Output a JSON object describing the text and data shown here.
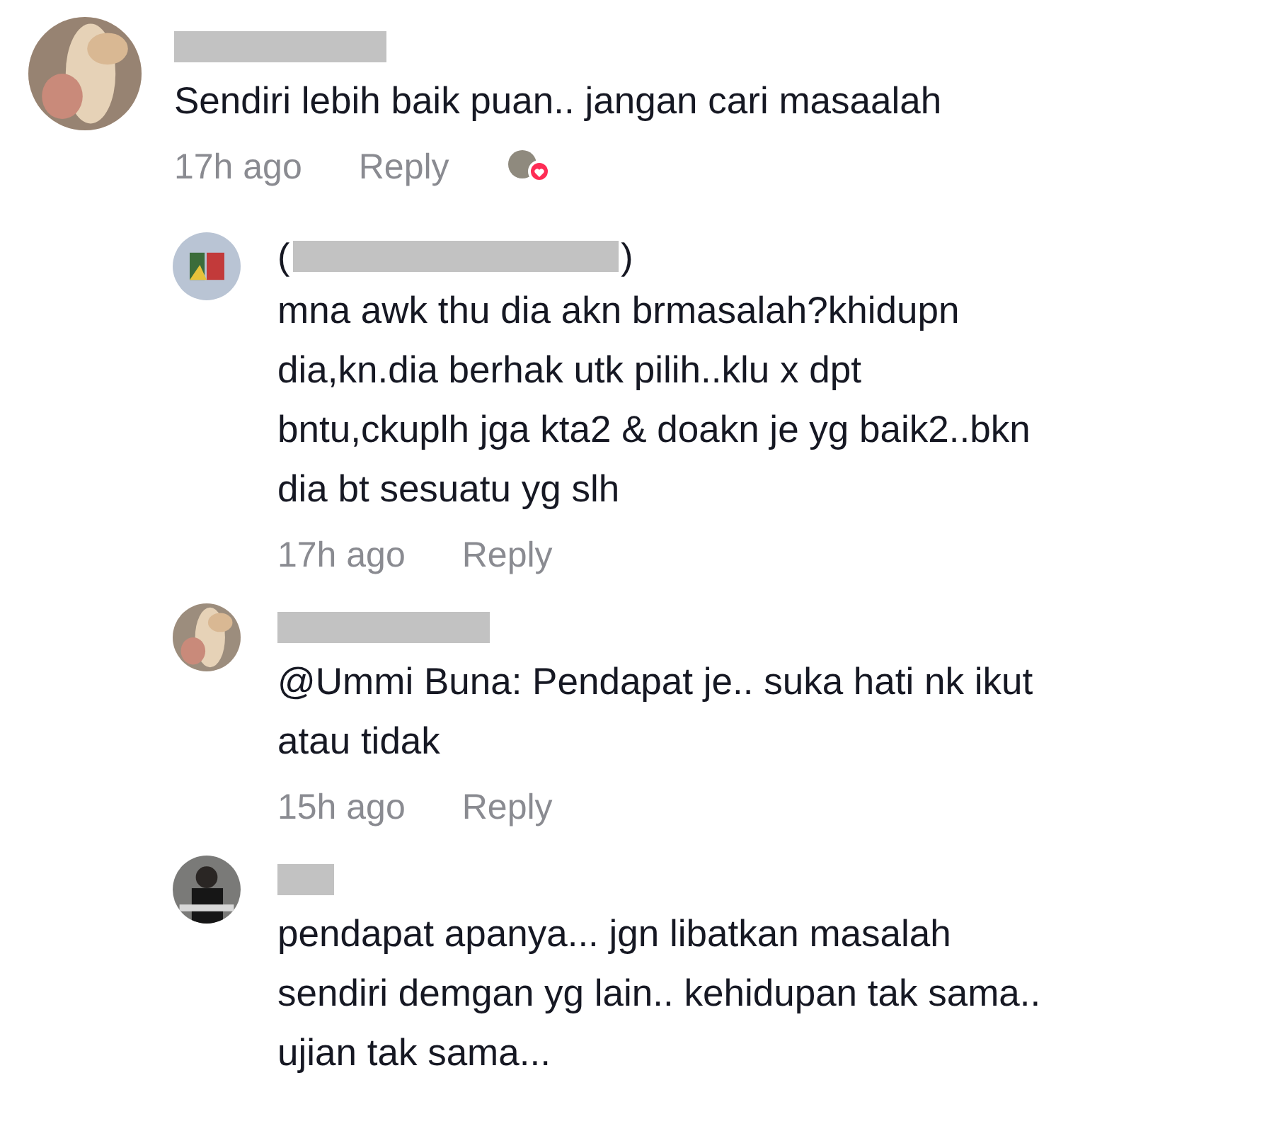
{
  "comments": [
    {
      "name_hidden": true,
      "text_lines": [
        "Sendiri lebih baik puan.. jangan cari masaalah"
      ],
      "time": "17h ago",
      "reply": "Reply",
      "creator_liked": true,
      "replies": [
        {
          "name_hidden": true,
          "name_prefix": "(",
          "name_suffix": ")",
          "text_lines": [
            "mna awk thu dia akn brmasalah?khidupn",
            "dia,kn.dia berhak utk pilih..klu x dpt",
            "bntu,ckuplh jga kta2 & doakn je yg baik2..bkn",
            "dia bt sesuatu yg slh"
          ],
          "time": "17h ago",
          "reply": "Reply",
          "creator_liked": false
        },
        {
          "name_hidden": true,
          "text_lines": [
            "@Ummi Buna: Pendapat je.. suka hati nk ikut",
            "atau tidak"
          ],
          "time": "15h ago",
          "reply": "Reply",
          "creator_liked": false
        },
        {
          "name_hidden": true,
          "text_lines": [
            "pendapat apanya... jgn libatkan masalah",
            "sendiri demgan yg lain.. kehidupan tak sama..",
            "ujian tak sama..."
          ],
          "creator_liked": false
        }
      ]
    }
  ]
}
